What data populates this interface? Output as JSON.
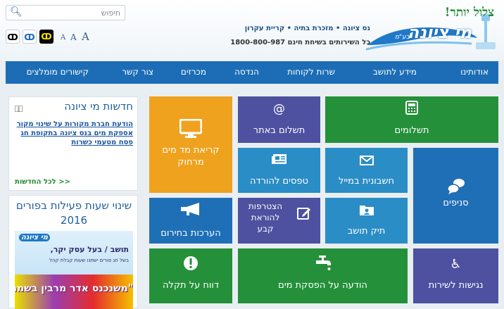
{
  "search": {
    "placeholder": "חיפוש",
    "value": ""
  },
  "accessibility": {
    "font_sizes": [
      "A",
      "A",
      "A"
    ]
  },
  "header": {
    "tagline": "נס ציונה • מזכרת בתיה • קריית עקרון",
    "service_line": "כל השירותים בשיחת חינם  1800-800-987",
    "slogan": "צלול יותר!",
    "brand": "מי ציונה",
    "brand_suffix": "בע\"מ"
  },
  "nav": [
    "אודותינו",
    "מידע לתושב",
    "שרות לקוחות",
    "הנדסה",
    "מכרזים",
    "צור קשר",
    "קישורים מומלצים"
  ],
  "news": {
    "title": "חדשות מי ציונה",
    "body": "הודעת חברת מקורות על שינוי מקור אספקת מים בנס ציונה בתקופת חג פסח מטעמי כשרות",
    "more": "לכל החדשות >>"
  },
  "hours": {
    "title": "שינוי שעות פעילות בפורים 2016",
    "banner_brand": "מי ציונה",
    "banner_line": "תושב / בעל עסק יקר,",
    "banner_sub": "בשל חג פורים ישתנו שעות קבלת קהל",
    "banner_slogan": "\"משנכנס אדר מרבין בשמחה\""
  },
  "tiles": {
    "payments": "תשלומים",
    "pay_online": "תשלום באתר",
    "remote_meter": "קריאת מד מים מרחוק",
    "email_bill": "חשבונית במייל",
    "download_forms": "טפסים להורדה",
    "branches": "סניפים",
    "direct_debit": "הצטרפות להוראת קבע",
    "resident_file": "תיק תושב",
    "emergency": "הערכות בחירום",
    "accessibility": "נגישות לשירות",
    "water_stop": "הודעה על הפסקת מים",
    "fault_report": "דווח על תקלה"
  },
  "colors": {
    "green": "#25903a",
    "purple": "#4d519f",
    "orange": "#efa21e",
    "blue": "#1f6fb7",
    "teal": "#2a8dc5",
    "nav": "#1c6db5"
  },
  "icons": {
    "payments": "calculator-icon",
    "pay_online": "at-sign-icon",
    "remote_meter": "monitor-icon",
    "email_bill": "envelope-icon",
    "download_forms": "newspaper-icon",
    "branches": "chat-bubbles-icon",
    "direct_debit": "edit-icon",
    "resident_file": "folder-user-icon",
    "emergency": "megaphone-icon",
    "accessibility": "wheelchair-icon",
    "water_stop": "faucet-icon",
    "fault_report": "exclamation-icon"
  }
}
